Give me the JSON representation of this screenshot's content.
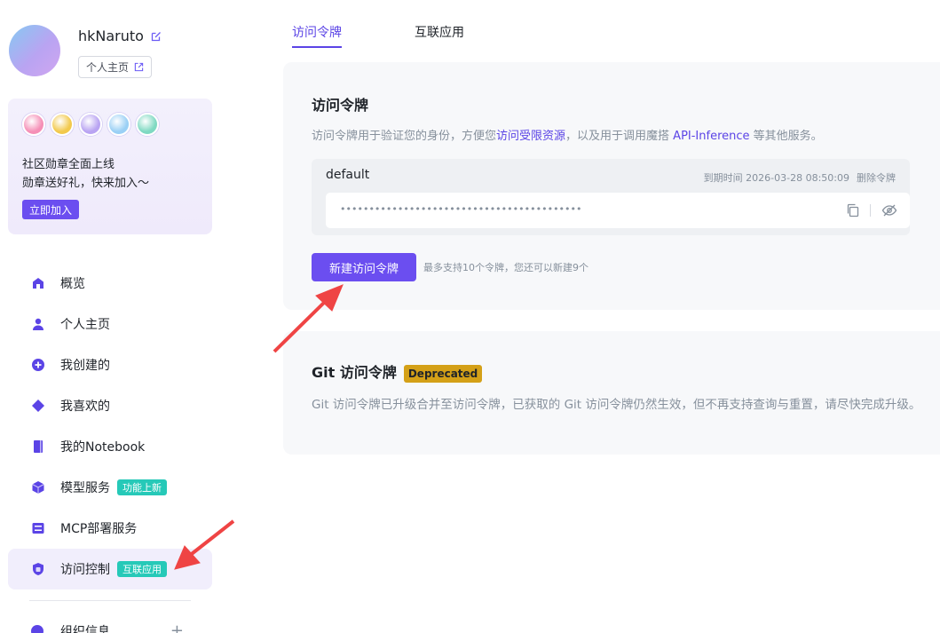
{
  "profile": {
    "username": "hkNaruto",
    "profile_link_label": "个人主页"
  },
  "promo": {
    "line1": "社区勋章全面上线",
    "line2": "勋章送好礼，快来加入～",
    "button_label": "立即加入",
    "badge_colors": [
      "#f58fb6",
      "#f2c94c",
      "#b9a4f2",
      "#9ad0f5",
      "#7fd9c2"
    ]
  },
  "nav": {
    "items": [
      {
        "label": "概览",
        "icon": "home-icon"
      },
      {
        "label": "个人主页",
        "icon": "user-icon"
      },
      {
        "label": "我创建的",
        "icon": "plus-circle-icon"
      },
      {
        "label": "我喜欢的",
        "icon": "diamond-icon"
      },
      {
        "label": "我的Notebook",
        "icon": "notebook-icon"
      },
      {
        "label": "模型服务",
        "icon": "cube-icon",
        "tag": "功能上新"
      },
      {
        "label": "MCP部署服务",
        "icon": "server-icon"
      },
      {
        "label": "访问控制",
        "icon": "shield-icon",
        "tag": "互联应用"
      }
    ],
    "partial_item_label": "组织信息"
  },
  "tabs": [
    {
      "label": "访问令牌"
    },
    {
      "label": "互联应用"
    }
  ],
  "access_token": {
    "title": "访问令牌",
    "desc_before": "访问令牌用于验证您的身份，方便您",
    "desc_link1": "访问受限资源",
    "desc_middle": "，以及用于调用魔搭 ",
    "desc_link2": "API-Inference",
    "desc_after": " 等其他服务。",
    "token_name": "default",
    "expiry_text": "到期时间 2026-03-28 08:50:09",
    "delete_label": "删除令牌",
    "token_value": "••••••••••••••••••••••••••••••••••••••••••",
    "new_button_label": "新建访问令牌",
    "limit_note": "最多支持10个令牌，您还可以新建9个"
  },
  "git_token": {
    "title": "Git 访问令牌",
    "deprecated_label": "Deprecated",
    "desc": "Git 访问令牌已升级合并至访问令牌，已获取的 Git 访问令牌仍然生效，但不再支持查询与重置，请尽快完成升级。"
  },
  "colors": {
    "accent": "#6b4ef0",
    "tag_teal": "#26c9b8",
    "deprecated_yellow": "#d4a017",
    "annotation_arrow": "#ef4444"
  }
}
